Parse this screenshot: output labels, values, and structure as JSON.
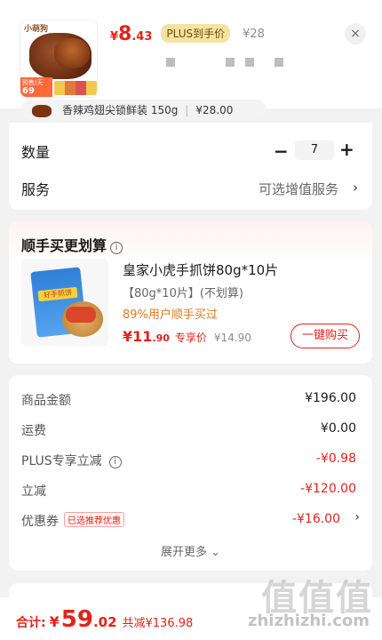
{
  "header": {
    "thumb_brand": "小萌狗",
    "thumb_tag_line1": "预售/天",
    "thumb_tag_price": "69",
    "price_currency": "¥",
    "price_int": "8",
    "price_dec": ".43",
    "plus_badge": "PLUS到手价",
    "original_price": "¥28",
    "close_icon": "×"
  },
  "spec": {
    "name": "香辣鸡翅尖锁鲜装 150g",
    "price": "¥28.00"
  },
  "options": {
    "qty_label": "数量",
    "qty_value": "7",
    "minus": "−",
    "plus": "+",
    "service_label": "服务",
    "service_value": "可选增值服务",
    "arrow": "›"
  },
  "addon": {
    "title": "顺手买更划算",
    "info_icon": "i",
    "product_name": "皇家小虎手抓饼80g*10片",
    "product_spec": "【80g*10片】(不划算)",
    "ratio_text": "89%用户顺手买过",
    "pack_label": "好手抓饼",
    "price_int": "¥11",
    "price_dec": ".90",
    "price_tag": "专享价",
    "original_price": "¥14.90",
    "buy_button": "一键购买"
  },
  "summary": {
    "rows": [
      {
        "label": "商品金额",
        "value": "¥196.00"
      },
      {
        "label": "运费",
        "value": "¥0.00"
      },
      {
        "label": "PLUS专享立减",
        "value": "-¥0.98"
      },
      {
        "label": "立减",
        "value": "-¥120.00"
      },
      {
        "label": "优惠券",
        "value": "-¥16.00"
      }
    ],
    "coupon_badge": "已选推荐优惠",
    "expand_more": "展开更多 ⌄"
  },
  "footer": {
    "total_label": "合计:",
    "currency": "¥",
    "total_int": "59",
    "total_dec": ".02",
    "saved": "共减¥136.98"
  },
  "watermark": {
    "main": "值值值",
    "sub": "zhizhizhi.com"
  },
  "colors": {
    "accent_red": "#e2231a",
    "plus_gold": "#f6e3a1"
  }
}
